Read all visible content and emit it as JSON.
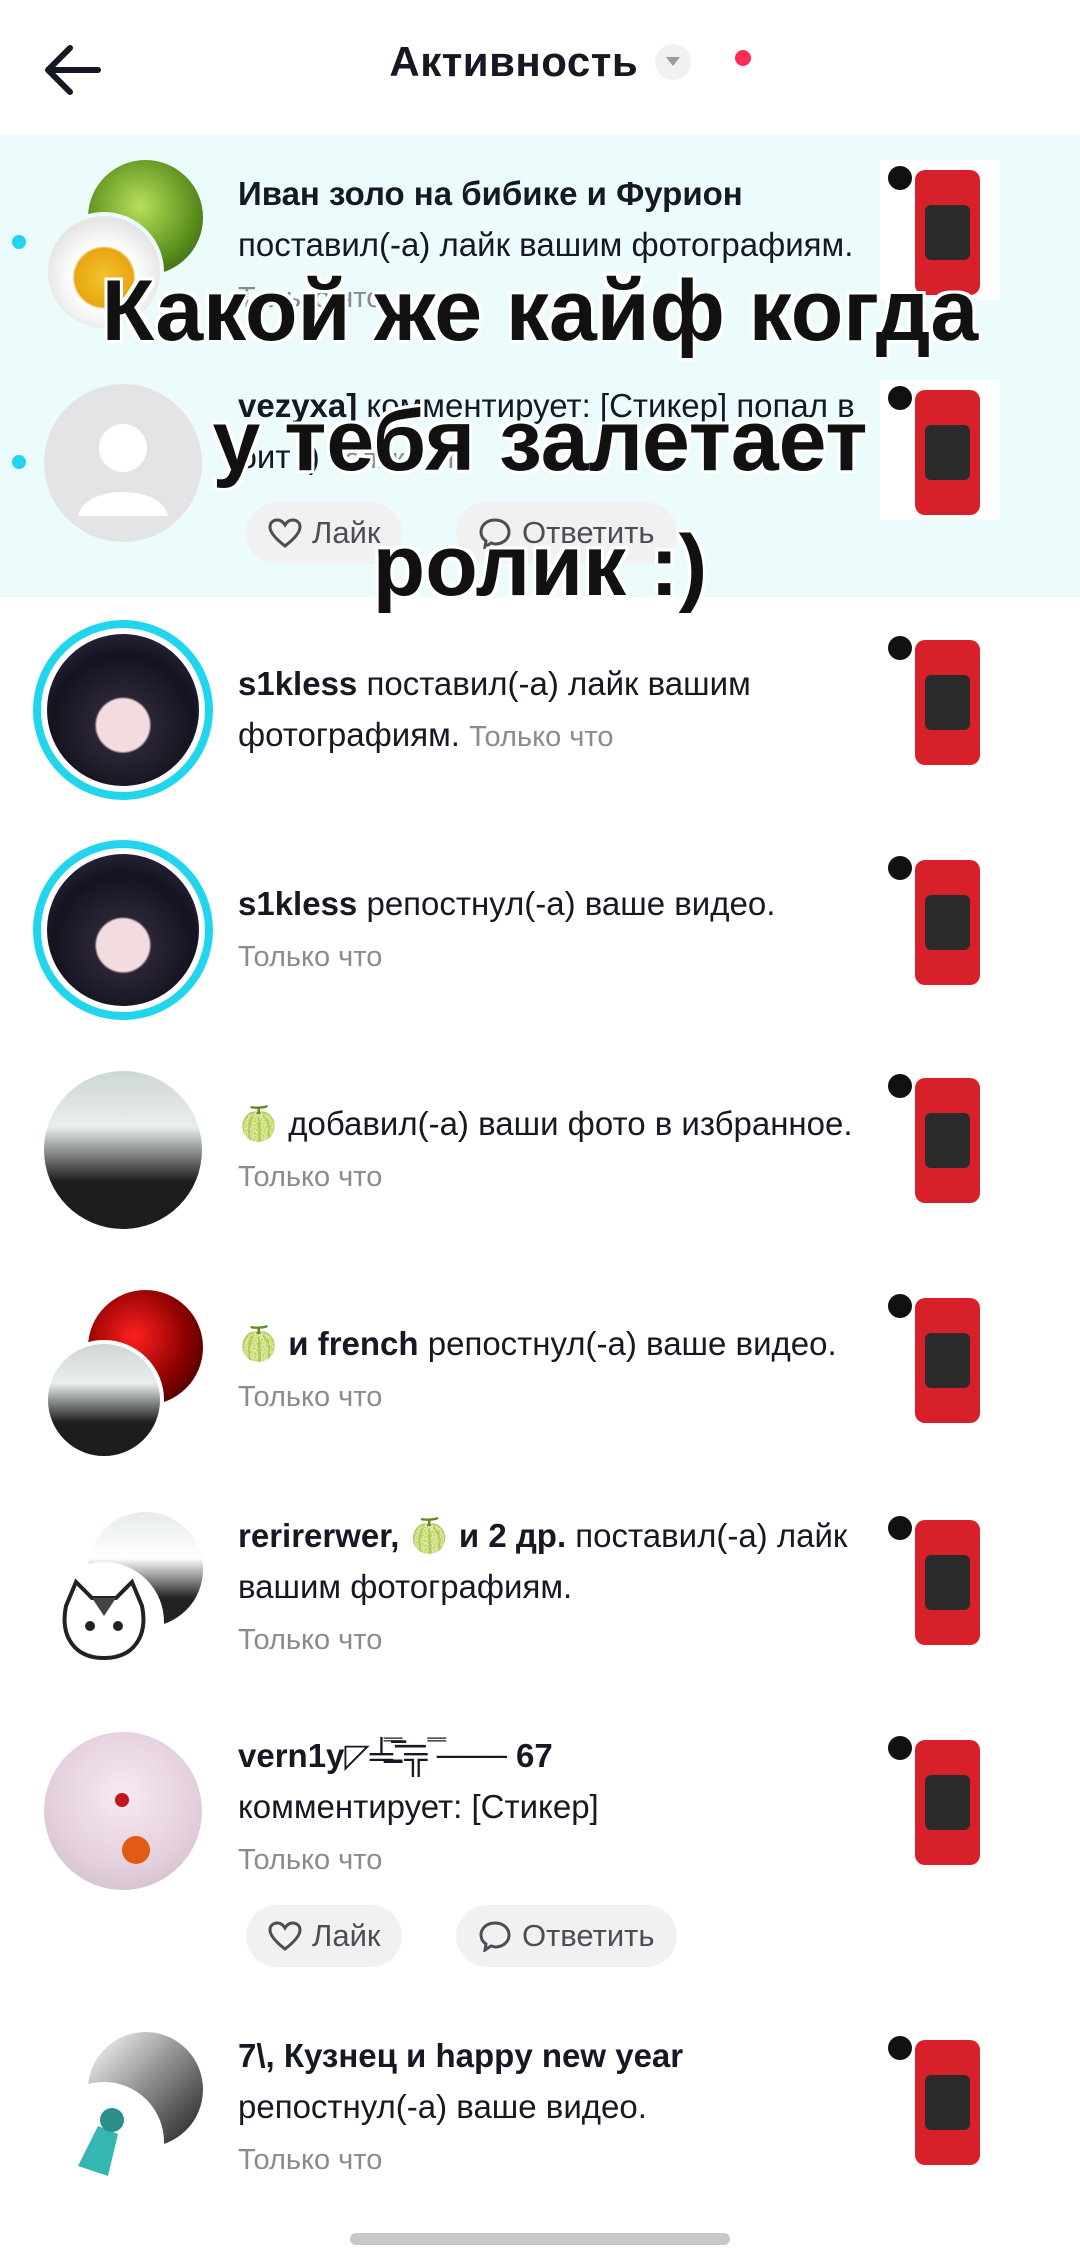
{
  "header": {
    "title": "Активность",
    "back_icon": "arrow-left-icon",
    "dropdown_icon": "chevron-down-icon",
    "notification_dot_color": "#fe2c55"
  },
  "overlay": {
    "lines": [
      "Какой же кайф когда",
      "у тебя залетает",
      "ролик :)"
    ]
  },
  "notifications": [
    {
      "user": "Иван золо на бибике и Фурион",
      "action": " поставил(-а) лайк вашим фотографиям.",
      "time": "Только что",
      "unread": true
    },
    {
      "user": "vezyxa]",
      "action": " комментирует: [Стикер] попал в бит :)",
      "time": "Только что",
      "unread": true,
      "actions": {
        "like": "Лайк",
        "reply": "Ответить"
      }
    },
    {
      "user": "s1kless",
      "action": " поставил(-а) лайк вашим фотографиям.",
      "time": "Только что"
    },
    {
      "user": "s1kless",
      "action": " репостнул(-а) ваше видео.",
      "time": "Только что"
    },
    {
      "user": "🍈",
      "action": " добавил(-а) ваши фото в избранное.",
      "time": "Только что"
    },
    {
      "user": "🍈 и french",
      "action": " репостнул(-а) ваше видео.",
      "time": "Только что"
    },
    {
      "user": "rerirerwer, 🍈 и 2 др.",
      "action": " поставил(-а) лайк вашим фотографиям.",
      "time": "Только что"
    },
    {
      "user": "vern1y◸╧̶̿‾͞╦ ̿─── 67",
      "action": " комментирует: [Стикер]",
      "time": "Только что",
      "actions": {
        "like": "Лайк",
        "reply": "Ответить"
      }
    },
    {
      "user": "7\\, Кузнец и happy new year",
      "action": " репостнул(-а) ваше видео.",
      "time": "Только что"
    }
  ],
  "colors": {
    "accent": "#20d5ec",
    "highlight": "#ecfbfb",
    "brand_red": "#fe2c55"
  }
}
